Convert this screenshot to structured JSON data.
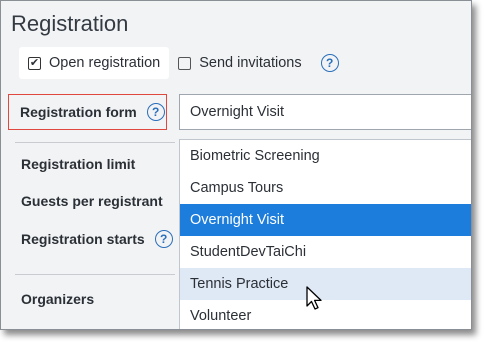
{
  "title": "Registration",
  "checkboxes": {
    "open_registration": {
      "label": "Open registration",
      "checked": true
    },
    "send_invitations": {
      "label": "Send invitations",
      "checked": false
    }
  },
  "help_glyph": "?",
  "fields": {
    "registration_form_label": "Registration form",
    "registration_form_value": "Overnight Visit",
    "registration_limit_label": "Registration limit",
    "guests_label": "Guests per registrant",
    "starts_label": "Registration starts",
    "organizers_label": "Organizers"
  },
  "dropdown": {
    "options": [
      "Biometric Screening",
      "Campus Tours",
      "Overnight Visit",
      "StudentDevTaiChi",
      "Tennis Practice",
      "Volunteer"
    ],
    "selected_index": 2,
    "hover_index": 4
  },
  "colors": {
    "accent": "#1c7ddc",
    "highlight_border": "#e0473f",
    "help": "#2a6fba"
  }
}
